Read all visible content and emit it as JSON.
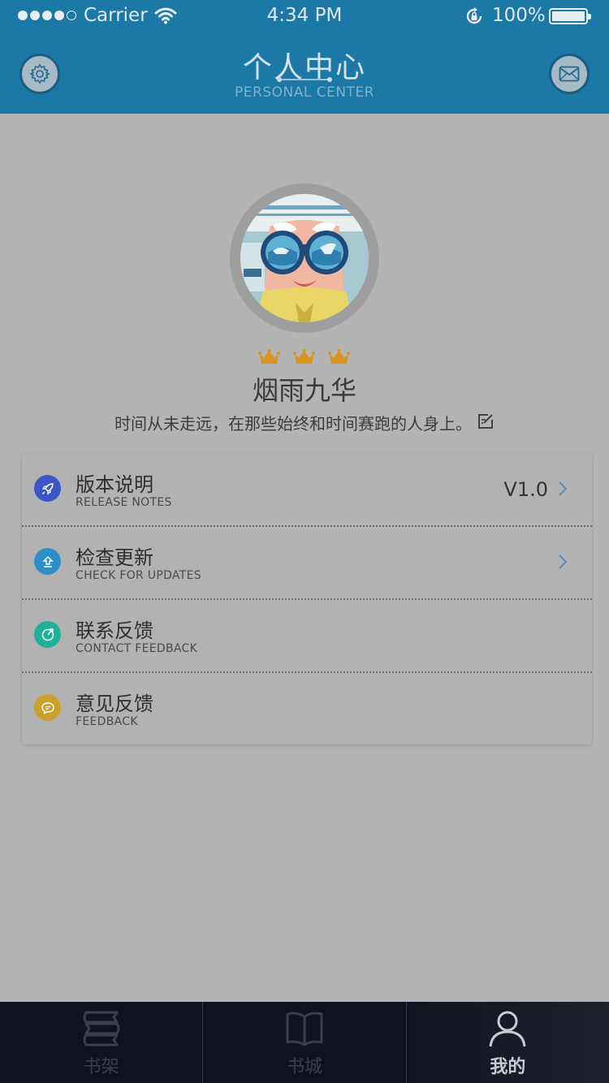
{
  "status_bar": {
    "carrier": "Carrier",
    "time": "4:34 PM",
    "battery": "100%"
  },
  "header": {
    "title": "个人中心",
    "subtitle": "PERSONAL CENTER",
    "settings_icon": "gear-icon",
    "mail_icon": "envelope-icon"
  },
  "profile": {
    "username": "烟雨九华",
    "motto": "时间从未走远，在那些始终和时间赛跑的人身上。",
    "crown_count": 3,
    "edit_icon": "edit-icon"
  },
  "menu": [
    {
      "label": "版本说明",
      "sub": "RELEASE NOTES",
      "value": "V1.0",
      "icon": "rocket-icon",
      "color": "#3a56c9",
      "chevron": true
    },
    {
      "label": "检查更新",
      "sub": "CHECK FOR UPDATES",
      "value": "",
      "icon": "upload-icon",
      "color": "#2d8fc7",
      "chevron": true
    },
    {
      "label": "联系反馈",
      "sub": "CONTACT FEEDBACK",
      "value": "",
      "icon": "compass-icon",
      "color": "#1fb09a",
      "chevron": false
    },
    {
      "label": "意见反馈",
      "sub": "FEEDBACK",
      "value": "",
      "icon": "chat-bubble-icon",
      "color": "#c9a12b",
      "chevron": false
    }
  ],
  "tabbar": {
    "tabs": [
      {
        "label": "书架",
        "icon": "bookshelf-icon",
        "active": false
      },
      {
        "label": "书城",
        "icon": "open-book-icon",
        "active": false
      },
      {
        "label": "我的",
        "icon": "user-icon",
        "active": true
      }
    ]
  },
  "colors": {
    "header_bg": "#1c78a4",
    "body_bg": "#b4b4b4",
    "tabbar_bg": "#0f1220"
  }
}
